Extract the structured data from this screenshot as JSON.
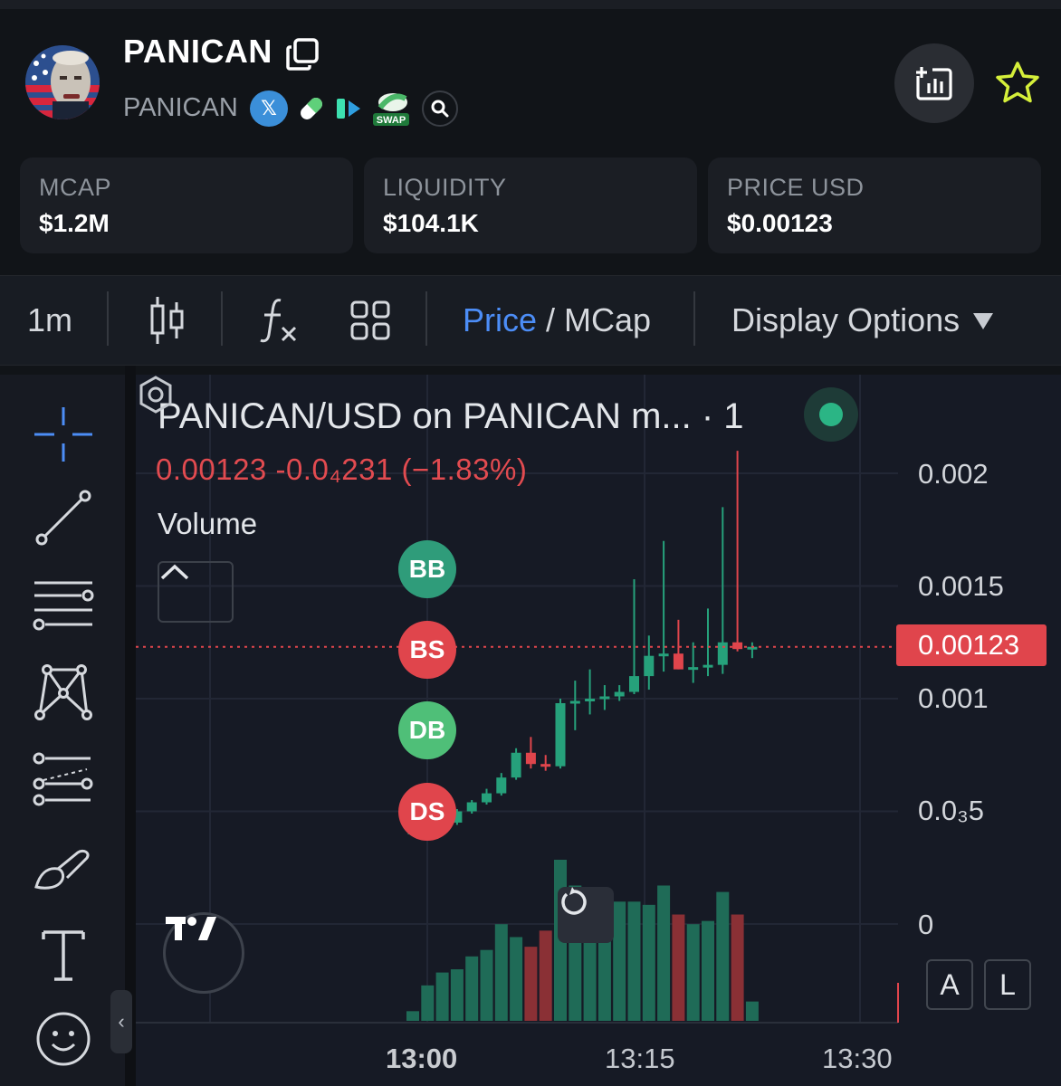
{
  "header": {
    "title": "PANICAN",
    "subtitle": "PANICAN",
    "x_badge": "𝕏",
    "swap_badge": "SWAP"
  },
  "stats": [
    {
      "label": "MCAP",
      "value": "$1.2M"
    },
    {
      "label": "LIQUIDITY",
      "value": "$104.1K"
    },
    {
      "label": "PRICE USD",
      "value": "$0.00123"
    }
  ],
  "toolbar": {
    "interval": "1m",
    "price_label": "Price",
    "slash": " / ",
    "mcap_label": "MCap",
    "display_options": "Display Options"
  },
  "chart": {
    "legend_title": "PANICAN/USD on PANICAN m... · 1",
    "ohlc_text": "0.00123  -0.0₄231 (−1.83%)",
    "volume_label": "Volume",
    "markers": [
      "BB",
      "BS",
      "DB",
      "DS"
    ],
    "current_price_label": "0.00123",
    "y_labels": [
      "0.002",
      "0.0015",
      "0.001",
      "0.0₃5",
      "0"
    ],
    "x_labels": [
      "13:00",
      "13:15",
      "13:30"
    ],
    "scale_buttons": [
      "A",
      "L"
    ],
    "colors": {
      "up": "#26a17b",
      "down": "#e0454c",
      "blue": "#4c8df6"
    }
  },
  "chart_data": {
    "type": "candlestick",
    "title": "PANICAN/USD on PANICAN m... · 1",
    "ylim": [
      0,
      0.0021
    ],
    "y_ticks": [
      0,
      0.0005,
      0.001,
      0.0015,
      0.002
    ],
    "x_ticks": [
      "13:00",
      "13:15",
      "13:30"
    ],
    "current_price": 0.00123,
    "candles": [
      {
        "o": 0.0004,
        "h": 0.00042,
        "l": 0.00039,
        "c": 0.00041
      },
      {
        "o": 0.00041,
        "h": 0.00043,
        "l": 0.0004,
        "c": 0.00042
      },
      {
        "o": 0.00042,
        "h": 0.00046,
        "l": 0.00041,
        "c": 0.00045
      },
      {
        "o": 0.00045,
        "h": 0.00051,
        "l": 0.00044,
        "c": 0.0005
      },
      {
        "o": 0.0005,
        "h": 0.00055,
        "l": 0.00049,
        "c": 0.00054
      },
      {
        "o": 0.00054,
        "h": 0.0006,
        "l": 0.00053,
        "c": 0.00058
      },
      {
        "o": 0.00058,
        "h": 0.00067,
        "l": 0.00057,
        "c": 0.00065
      },
      {
        "o": 0.00065,
        "h": 0.00078,
        "l": 0.00064,
        "c": 0.00076
      },
      {
        "o": 0.00076,
        "h": 0.00083,
        "l": 0.00069,
        "c": 0.00071
      },
      {
        "o": 0.00071,
        "h": 0.00075,
        "l": 0.00068,
        "c": 0.0007
      },
      {
        "o": 0.0007,
        "h": 0.001,
        "l": 0.00069,
        "c": 0.00098
      },
      {
        "o": 0.00098,
        "h": 0.00108,
        "l": 0.00086,
        "c": 0.00099
      },
      {
        "o": 0.00099,
        "h": 0.00113,
        "l": 0.00093,
        "c": 0.001
      },
      {
        "o": 0.001,
        "h": 0.00106,
        "l": 0.00095,
        "c": 0.00101
      },
      {
        "o": 0.00101,
        "h": 0.00106,
        "l": 0.00099,
        "c": 0.00103
      },
      {
        "o": 0.00103,
        "h": 0.00153,
        "l": 0.00102,
        "c": 0.0011
      },
      {
        "o": 0.0011,
        "h": 0.00128,
        "l": 0.00104,
        "c": 0.00119
      },
      {
        "o": 0.00119,
        "h": 0.0017,
        "l": 0.00112,
        "c": 0.0012
      },
      {
        "o": 0.0012,
        "h": 0.00135,
        "l": 0.00113,
        "c": 0.00113
      },
      {
        "o": 0.00113,
        "h": 0.00125,
        "l": 0.00107,
        "c": 0.00114
      },
      {
        "o": 0.00114,
        "h": 0.0014,
        "l": 0.0011,
        "c": 0.00115
      },
      {
        "o": 0.00115,
        "h": 0.00185,
        "l": 0.00111,
        "c": 0.00125
      },
      {
        "o": 0.00125,
        "h": 0.0021,
        "l": 0.00121,
        "c": 0.00122
      },
      {
        "o": 0.00122,
        "h": 0.00125,
        "l": 0.00118,
        "c": 0.00123
      }
    ],
    "volume_relative": [
      0.06,
      0.22,
      0.3,
      0.32,
      0.4,
      0.44,
      0.6,
      0.52,
      0.46,
      0.56,
      1.0,
      0.84,
      0.78,
      0.8,
      0.74,
      0.74,
      0.72,
      0.84,
      0.66,
      0.6,
      0.62,
      0.8,
      0.66,
      0.12
    ]
  }
}
